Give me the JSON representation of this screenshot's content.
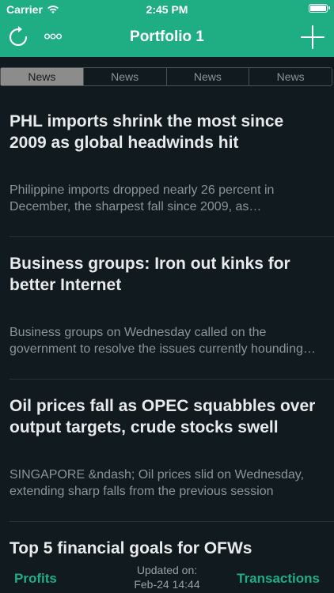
{
  "status": {
    "carrier": "Carrier",
    "time": "2:45 PM"
  },
  "nav": {
    "title": "Portfolio 1",
    "left_icons": [
      "refresh-icon",
      "more-icon"
    ],
    "right_icon": "add-icon"
  },
  "tabs": [
    {
      "label": "News",
      "active": true
    },
    {
      "label": "News",
      "active": false
    },
    {
      "label": "News",
      "active": false
    },
    {
      "label": "News",
      "active": false
    }
  ],
  "news": [
    {
      "title": "PHL imports shrink the most since 2009 as global headwinds hit",
      "summary": "Philippine imports dropped nearly 26 percent in December, the sharpest fall since 2009, as semiconductor shipments slumped"
    },
    {
      "title": "Business groups: Iron out kinks for better Internet",
      "summary": "Business groups on Wednesday called on the government to resolve the issues currently hounding the country's Internet"
    },
    {
      "title": "Oil prices fall as OPEC squabbles over output targets, crude stocks swell",
      "summary": "SINGAPORE &ndash; Oil prices slid on Wednesday, extending sharp falls from the previous session"
    },
    {
      "title": "Top 5 financial goals for OFWs",
      "summary": ""
    }
  ],
  "bottom": {
    "profits": "Profits",
    "transactions": "Transactions",
    "updated_label": "Updated on:",
    "updated_time": "Feb-24 14:44"
  },
  "colors": {
    "accent": "#1fae83",
    "background": "#101a1f"
  }
}
